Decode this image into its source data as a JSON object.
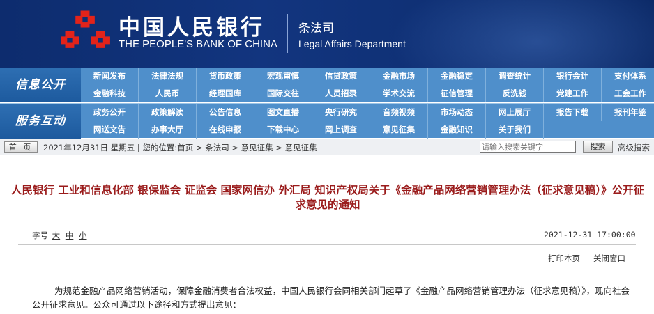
{
  "header": {
    "bank_name_cn": "中国人民银行",
    "bank_name_en": "THE PEOPLE'S BANK OF CHINA",
    "dept_cn": "条法司",
    "dept_en": "Legal Affairs Department",
    "logo_color": "#e2231a"
  },
  "nav": {
    "info_label": "信息公开",
    "info_row1": [
      "新闻发布",
      "法律法规",
      "货币政策",
      "宏观审慎",
      "信贷政策",
      "金融市场",
      "金融稳定",
      "调查统计",
      "银行会计",
      "支付体系"
    ],
    "info_row2": [
      "金融科技",
      "人民币",
      "经理国库",
      "国际交往",
      "人员招录",
      "学术交流",
      "征信管理",
      "反洗钱",
      "党建工作",
      "工会工作"
    ],
    "service_label": "服务互动",
    "service_row1": [
      "政务公开",
      "政策解读",
      "公告信息",
      "图文直播",
      "央行研究",
      "音频视频",
      "市场动态",
      "网上展厅",
      "报告下载",
      "报刊年鉴"
    ],
    "service_row2": [
      "网送文告",
      "办事大厅",
      "在线申报",
      "下载中心",
      "网上调查",
      "意见征集",
      "金融知识",
      "关于我们"
    ]
  },
  "crumb": {
    "home": "首 页",
    "text": "2021年12月31日 星期五 | 您的位置:首页 > 条法司 > 意见征集 > 意见征集",
    "search_placeholder": "请输入搜索关键字",
    "search_button": "搜索",
    "advanced": "高级搜索"
  },
  "article": {
    "title": "人民银行 工业和信息化部 银保监会 证监会 国家网信办 外汇局 知识产权局关于《金融产品网络营销管理办法（征求意见稿）》公开征求意见的通知",
    "font_label": "字号",
    "font_large": "大",
    "font_medium": "中",
    "font_small": "小",
    "date": "2021-12-31 17:00:00",
    "print": "打印本页",
    "close": "关闭窗口",
    "body": "为规范金融产品网络营销活动，保障金融消费者合法权益，中国人民银行会同相关部门起草了《金融产品网络营销管理办法（征求意见稿）》，现向社会公开征求意见。公众可通过以下途径和方式提出意见："
  }
}
